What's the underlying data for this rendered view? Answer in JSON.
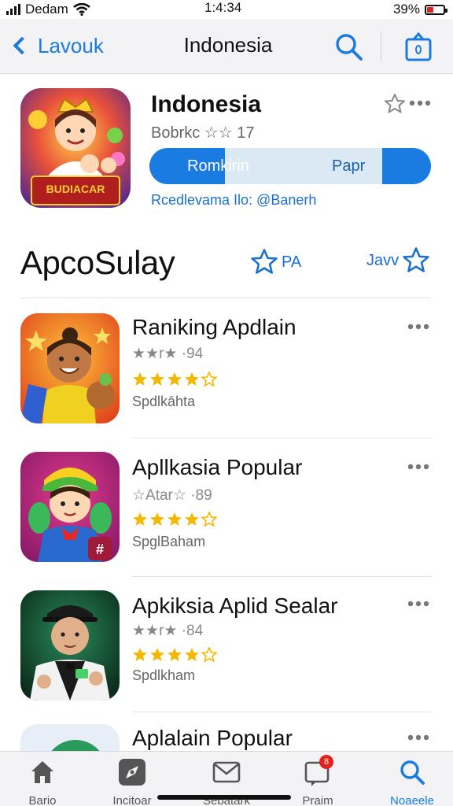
{
  "status_bar": {
    "carrier": "Dedam",
    "time": "1:4:34",
    "battery": "39%",
    "battery_level": 0.39
  },
  "nav": {
    "back_label": "Lavouk",
    "title": "Indonesia",
    "search_icon": "search-icon",
    "share_icon": "share-icon"
  },
  "featured": {
    "title": "Indonesia",
    "subtitle": "Bobrkc ☆☆ 17",
    "pill_left": "Romkirin",
    "pill_right": "Papr",
    "link": "Rcedlevama Ilo: @Banerh",
    "icon_text": "BUDIACAR"
  },
  "section": {
    "title": "ApcoSulay",
    "left_action": "PA",
    "right_action": "Javv"
  },
  "apps": [
    {
      "name": "Raniking Apdlain",
      "meta": "★★r★ ·94",
      "rating": 4,
      "sub": "Spdlkāhta"
    },
    {
      "name": "Apllkasia Popular",
      "meta": "☆Atar☆ ·89",
      "rating": 4,
      "sub": "SpglBaham"
    },
    {
      "name": "Apkiksia Aplid Sealar",
      "meta": "★★r★ ·84",
      "rating": 4,
      "sub": "Spdlkham"
    },
    {
      "name": "Aplalain Popular",
      "meta": "",
      "rating": 0,
      "sub": ""
    }
  ],
  "tabs": [
    {
      "label": "Bario",
      "icon": "home-icon"
    },
    {
      "label": "Incitoar",
      "icon": "compass-icon"
    },
    {
      "label": "Sebatark",
      "icon": "mail-icon"
    },
    {
      "label": "Praim",
      "icon": "notification-icon",
      "badge": "8"
    },
    {
      "label": "Noaeele",
      "icon": "search-icon",
      "active": true
    }
  ],
  "colors": {
    "accent": "#1a7be0",
    "star": "#f5b800"
  }
}
